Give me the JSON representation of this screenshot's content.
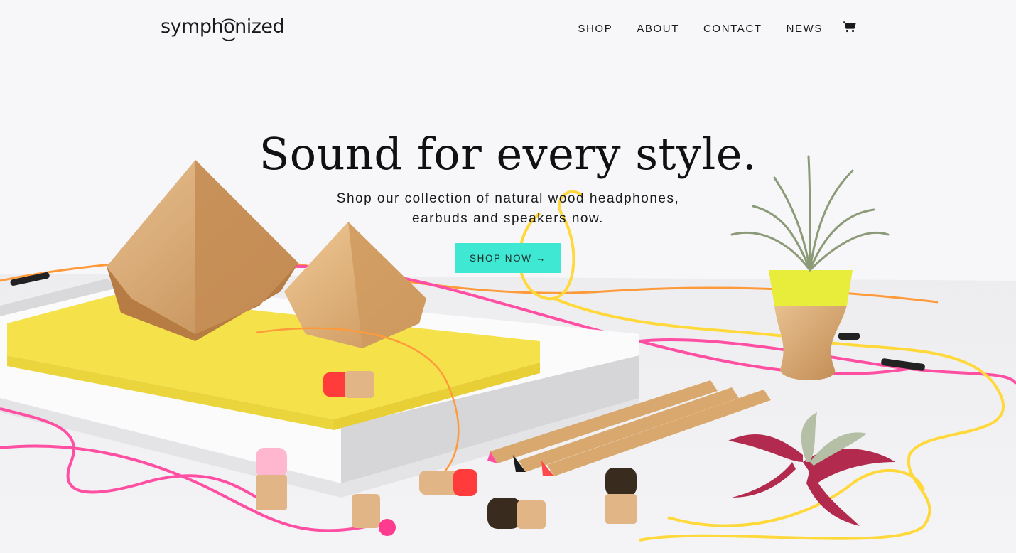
{
  "brand": {
    "logo_text_left": "symph",
    "logo_text_right": "nized",
    "logo_glyph": "o"
  },
  "nav": {
    "items": [
      {
        "label": "SHOP"
      },
      {
        "label": "ABOUT"
      },
      {
        "label": "CONTACT"
      },
      {
        "label": "NEWS"
      }
    ],
    "cart_icon": "cart-icon"
  },
  "hero": {
    "title": "Sound for every style.",
    "subtitle_line1": "Shop our collection of natural wood headphones,",
    "subtitle_line2": "earbuds and speakers now.",
    "cta_label": "SHOP NOW →"
  },
  "colors": {
    "background": "#f7f7f9",
    "cta": "#3ee8d2",
    "notebook_yellow": "#f5e24a",
    "cable_pink": "#ff4fa3",
    "cable_yellow": "#ffd93b",
    "wood": "#d9a86e"
  }
}
